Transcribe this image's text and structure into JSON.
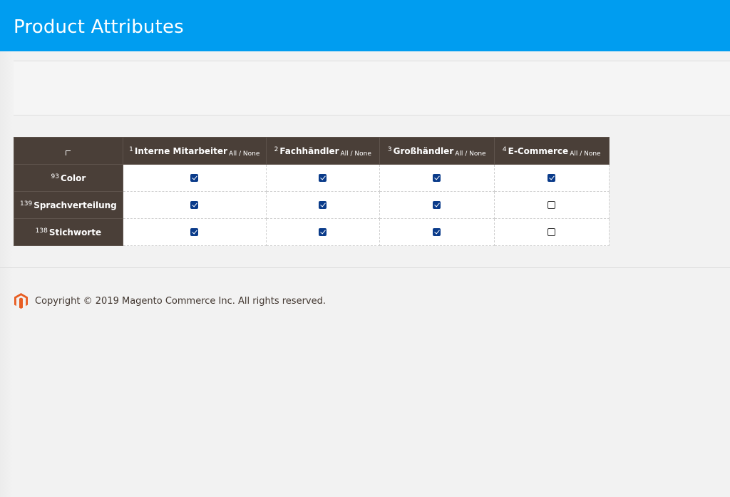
{
  "header": {
    "title": "Product Attributes"
  },
  "table": {
    "columns": [
      {
        "num": "1",
        "label": "Interne Mitarbeiter",
        "all_none": "All / None"
      },
      {
        "num": "2",
        "label": "Fachhändler",
        "all_none": "All / None"
      },
      {
        "num": "3",
        "label": "Großhändler",
        "all_none": "All / None"
      },
      {
        "num": "4",
        "label": "E-Commerce",
        "all_none": "All / None"
      }
    ],
    "rows": [
      {
        "num": "93",
        "label": "Color",
        "checked": [
          true,
          true,
          true,
          true
        ]
      },
      {
        "num": "139",
        "label": "Sprachverteilung",
        "checked": [
          true,
          true,
          true,
          false
        ]
      },
      {
        "num": "138",
        "label": "Stichworte",
        "checked": [
          true,
          true,
          true,
          false
        ]
      }
    ]
  },
  "footer": {
    "copyright": "Copyright © 2019 Magento Commerce Inc. All rights reserved."
  },
  "colors": {
    "header": "#009df0",
    "table_header": "#4a3f38",
    "checkbox": "#0a3b8a",
    "logo": "#e85d22"
  }
}
